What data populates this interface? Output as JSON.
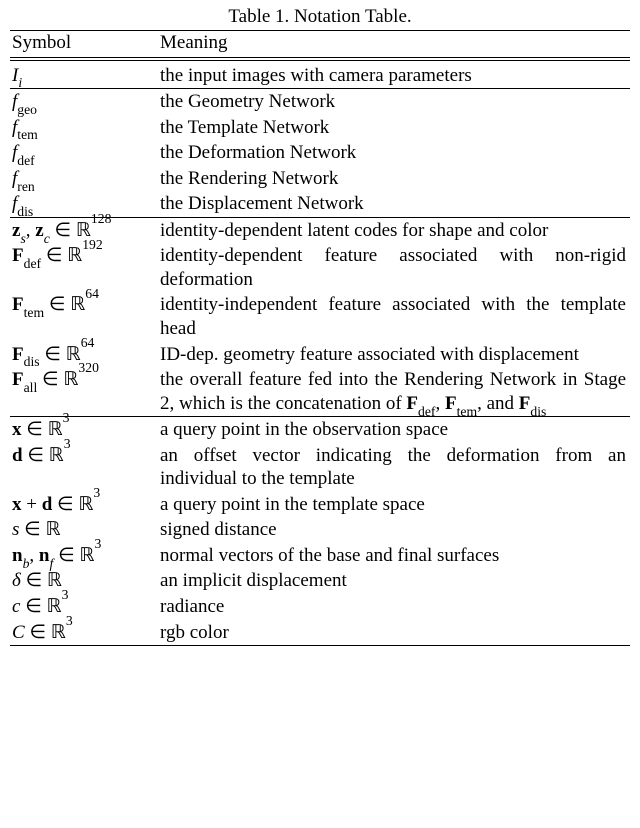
{
  "caption": "Table 1. Notation Table.",
  "header": {
    "symbol": "Symbol",
    "meaning": "Meaning"
  },
  "groups": [
    {
      "rows": [
        {
          "symbol_html": "<span class='mi'>I<sub>i</sub></span>",
          "meaning": "the input images with camera parameters"
        }
      ]
    },
    {
      "rows": [
        {
          "symbol_html": "<span class='mi'>f</span><sub class='sub-rm'>geo</sub>",
          "meaning": "the Geometry Network"
        },
        {
          "symbol_html": "<span class='mi'>f</span><sub class='sub-rm'>tem</sub>",
          "meaning": "the Template Network"
        },
        {
          "symbol_html": "<span class='mi'>f</span><sub class='sub-rm'>def</sub>",
          "meaning": "the Deformation Network"
        },
        {
          "symbol_html": "<span class='mi'>f</span><sub class='sub-rm'>ren</sub>",
          "meaning": "the Rendering Network"
        },
        {
          "symbol_html": "<span class='mi'>f</span><sub class='sub-rm'>dis</sub>",
          "meaning": "the Displacement Network"
        }
      ]
    },
    {
      "rows": [
        {
          "symbol_html": "<b>z</b><sub><span class='mi'>s</span></sub>, <b>z</b><sub><span class='mi'>c</span></sub> ∈ <span class='bb'>ℝ</span><sup>128</sup>",
          "meaning": "identity-dependent latent codes for shape and color"
        },
        {
          "symbol_html": "<b>F</b><sub class='sub-rm'>def</sub> ∈ <span class='bb'>ℝ</span><sup>192</sup>",
          "meaning": "identity-dependent feature associated with non-rigid deformation"
        },
        {
          "symbol_html": "<b>F</b><sub class='sub-rm'>tem</sub> ∈ <span class='bb'>ℝ</span><sup>64</sup>",
          "meaning": "identity-independent feature associated with the template head"
        },
        {
          "symbol_html": "<b>F</b><sub class='sub-rm'>dis</sub> ∈ <span class='bb'>ℝ</span><sup>64</sup>",
          "meaning": "ID-dep.  geometry feature associated with dis­placement"
        },
        {
          "symbol_html": "<b>F</b><sub class='sub-rm'>all</sub> ∈ <span class='bb'>ℝ</span><sup>320</sup>",
          "meaning_html": "the overall feature fed into the Rendering Network in Stage 2, which is the concatenation of <b>F</b><sub class='sub-rm'>def</sub>, <b>F</b><sub class='sub-rm'>tem</sub>, and <b>F</b><sub class='sub-rm'>dis</sub>"
        }
      ]
    },
    {
      "rows": [
        {
          "symbol_html": "<b>x</b> ∈ <span class='bb'>ℝ</span><sup>3</sup>",
          "meaning": "a query point in the observation space"
        },
        {
          "symbol_html": "<b>d</b> ∈ <span class='bb'>ℝ</span><sup>3</sup>",
          "meaning": "an offset vector indicating the deformation from an individual to the template"
        },
        {
          "symbol_html": "<b>x</b> + <b>d</b> ∈ <span class='bb'>ℝ</span><sup>3</sup>",
          "meaning": "a query point in the template space"
        },
        {
          "symbol_html": "<span class='mi'>s</span> ∈ <span class='bb'>ℝ</span>",
          "meaning": "signed distance"
        },
        {
          "symbol_html": "<b>n</b><sub><span class='mi'>b</span></sub>, <b>n</b><sub><span class='mi'>f</span></sub> ∈ <span class='bb'>ℝ</span><sup>3</sup>",
          "meaning": "normal vectors of the base and final surfaces"
        },
        {
          "symbol_html": "<span class='mi'>δ</span> ∈ <span class='bb'>ℝ</span>",
          "meaning": "an implicit displacement"
        },
        {
          "symbol_html": "<span class='mi'>c</span> ∈ <span class='bb'>ℝ</span><sup>3</sup>",
          "meaning": "radiance"
        },
        {
          "symbol_html": "<span class='mi'>C</span> ∈ <span class='bb'>ℝ</span><sup>3</sup>",
          "meaning": "rgb color"
        }
      ]
    }
  ],
  "chart_data": {
    "type": "table",
    "title": "Table 1. Notation Table.",
    "columns": [
      "Symbol",
      "Meaning"
    ],
    "rows": [
      [
        "I_i",
        "the input images with camera parameters"
      ],
      [
        "f_geo",
        "the Geometry Network"
      ],
      [
        "f_tem",
        "the Template Network"
      ],
      [
        "f_def",
        "the Deformation Network"
      ],
      [
        "f_ren",
        "the Rendering Network"
      ],
      [
        "f_dis",
        "the Displacement Network"
      ],
      [
        "z_s, z_c ∈ ℝ^128",
        "identity-dependent latent codes for shape and color"
      ],
      [
        "F_def ∈ ℝ^192",
        "identity-dependent feature associated with non-rigid deformation"
      ],
      [
        "F_tem ∈ ℝ^64",
        "identity-independent feature associated with the template head"
      ],
      [
        "F_dis ∈ ℝ^64",
        "ID-dep. geometry feature associated with displacement"
      ],
      [
        "F_all ∈ ℝ^320",
        "the overall feature fed into the Rendering Network in Stage 2, which is the concatenation of F_def, F_tem, and F_dis"
      ],
      [
        "x ∈ ℝ^3",
        "a query point in the observation space"
      ],
      [
        "d ∈ ℝ^3",
        "an offset vector indicating the deformation from an individual to the template"
      ],
      [
        "x + d ∈ ℝ^3",
        "a query point in the template space"
      ],
      [
        "s ∈ ℝ",
        "signed distance"
      ],
      [
        "n_b, n_f ∈ ℝ^3",
        "normal vectors of the base and final surfaces"
      ],
      [
        "δ ∈ ℝ",
        "an implicit displacement"
      ],
      [
        "c ∈ ℝ^3",
        "radiance"
      ],
      [
        "C ∈ ℝ^3",
        "rgb color"
      ]
    ]
  }
}
